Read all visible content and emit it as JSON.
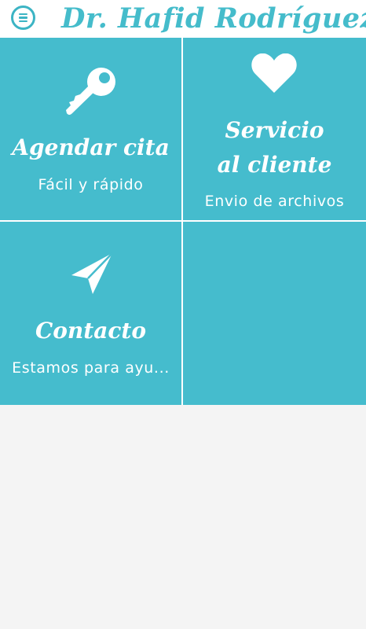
{
  "header": {
    "title": "Dr. Hafid Rodríguez",
    "menu_icon": "hamburger-menu-icon"
  },
  "tiles": [
    {
      "title": "Agendar cita",
      "subtitle": "Fácil y rápido",
      "icon": "key-icon"
    },
    {
      "title_line1": "Servicio",
      "title_line2": "al cliente",
      "subtitle": "Envio de archivos",
      "icon": "heart-icon"
    },
    {
      "title": "Contacto",
      "subtitle": "Estamos para ayu...",
      "icon": "paper-plane-icon"
    }
  ],
  "colors": {
    "accent": "#45bccd",
    "title_text": "#45bccb",
    "background": "#f4f4f4",
    "header_bg": "#ffffff"
  }
}
